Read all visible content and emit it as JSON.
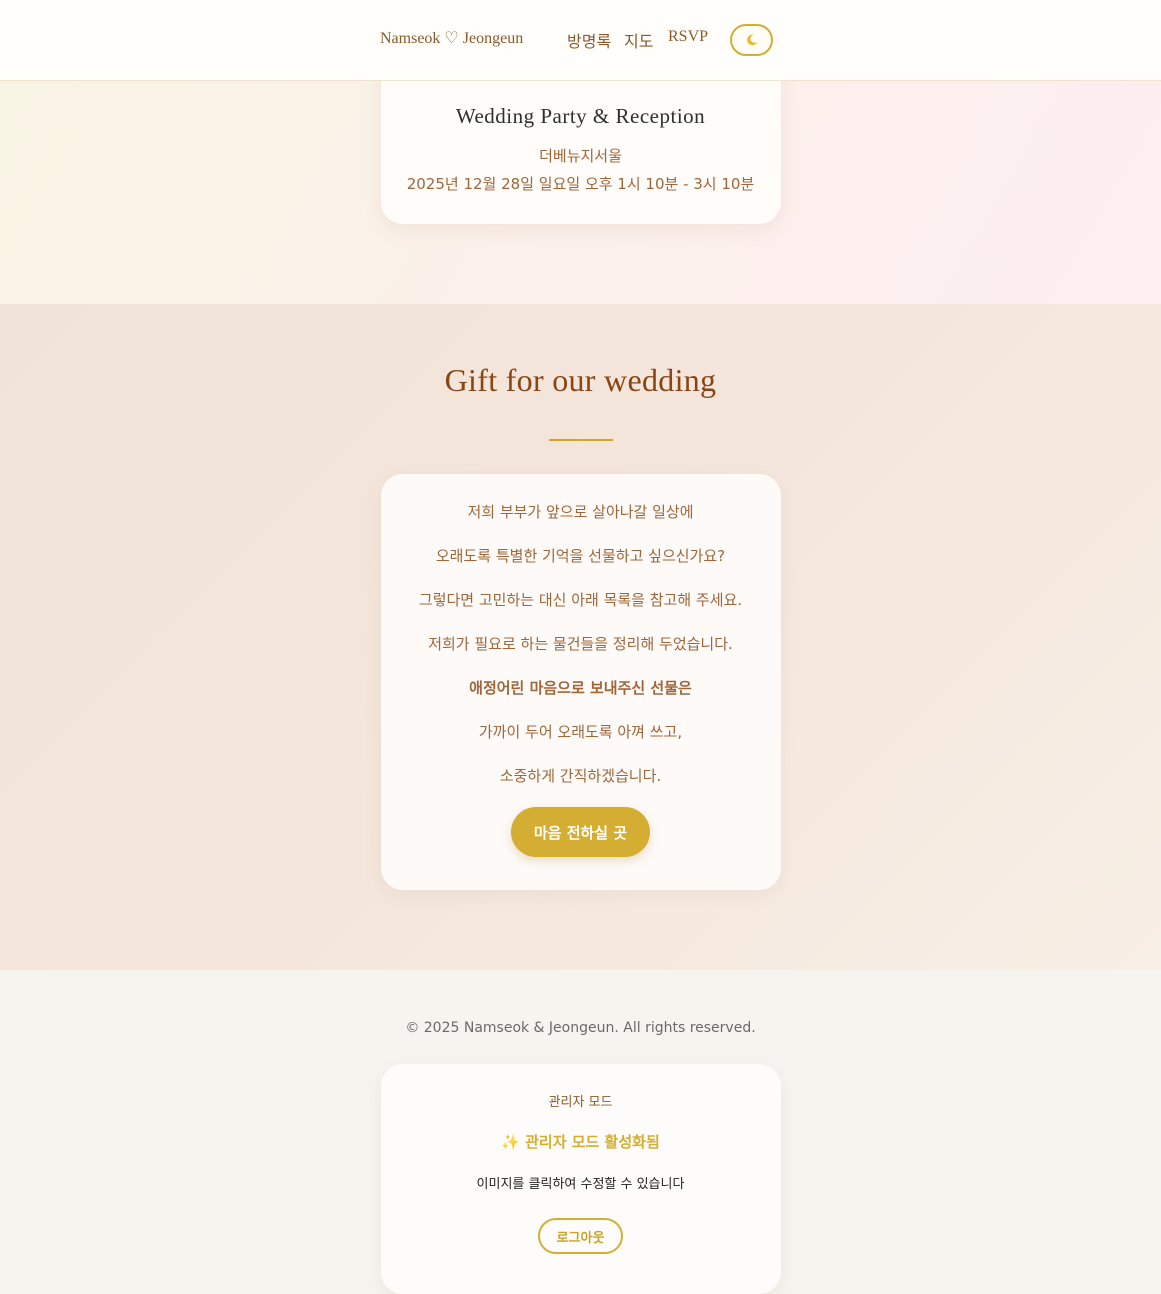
{
  "header": {
    "brand": "Namseok ♡ Jeongeun",
    "nav": [
      {
        "label": "방명록"
      },
      {
        "label": "지도"
      },
      {
        "label": "RSVP"
      }
    ],
    "theme_toggle_icon": "moon-icon"
  },
  "reception": {
    "title": "Wedding Party & Reception",
    "venue": "더베뉴지서울",
    "datetime": "2025년 12월 28일 일요일 오후 1시 10분 - 3시 10분"
  },
  "gift": {
    "title": "Gift for our wedding",
    "lines": [
      "저희 부부가 앞으로 살아나갈 일상에",
      "오래도록 특별한 기억을 선물하고 싶으신가요?",
      "그렇다면 고민하는 대신 아래 목록을 참고해 주세요.",
      "저희가 필요로 하는 물건들을 정리해 두었습니다.",
      "애정어린 마음으로 보내주신 선물은",
      "가까이 두어 오래도록 아껴 쓰고,",
      "소중하게 간직하겠습니다."
    ],
    "button_label": "마음 전하실 곳"
  },
  "footer": {
    "copyright": "© 2025 Namseok & Jeongeun. All rights reserved.",
    "admin": {
      "label": "관리자 모드",
      "status": "✨ 관리자 모드 활성화됨",
      "hint": "이미지를 클릭하여 수정할 수 있습니다",
      "logout_label": "로그아웃"
    }
  },
  "colors": {
    "accent": "#d4ae32",
    "brown": "#8b4513",
    "text_brown": "#a0663a"
  }
}
